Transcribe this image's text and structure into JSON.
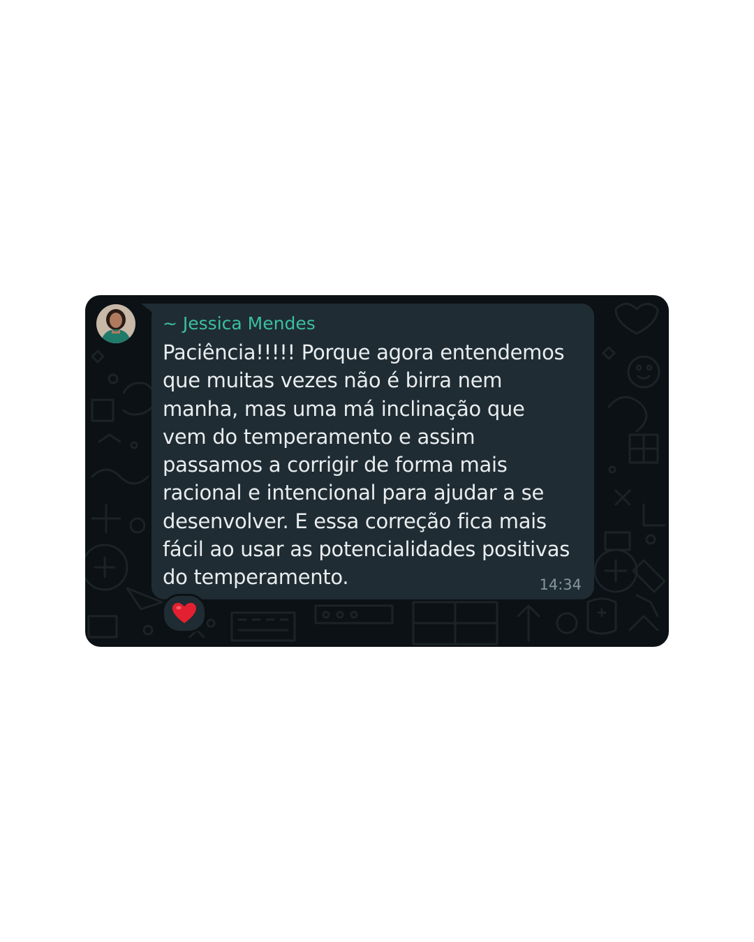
{
  "chat": {
    "sender_name": "~ Jessica Mendes",
    "message_lines": [
      "Paciência!!!!! Porque agora entendemos",
      "que muitas vezes não é birra nem",
      "manha, mas uma má inclinação que",
      "vem do temperamento e assim",
      "passamos a corrigir de forma mais",
      "racional e intencional para ajudar a se",
      "desenvolver. E essa correção fica mais",
      "fácil ao usar as potencialidades positivas",
      "do temperamento."
    ],
    "timestamp": "14:34",
    "reaction_icon": "red-heart-icon",
    "avatar_icon": "user-avatar"
  },
  "colors": {
    "background": "#0b1114",
    "bubble": "#1f2c33",
    "sender_name": "#3bbfa2",
    "message_text": "#e9edef",
    "timestamp": "#8696a0",
    "heart": "#e3202f"
  }
}
